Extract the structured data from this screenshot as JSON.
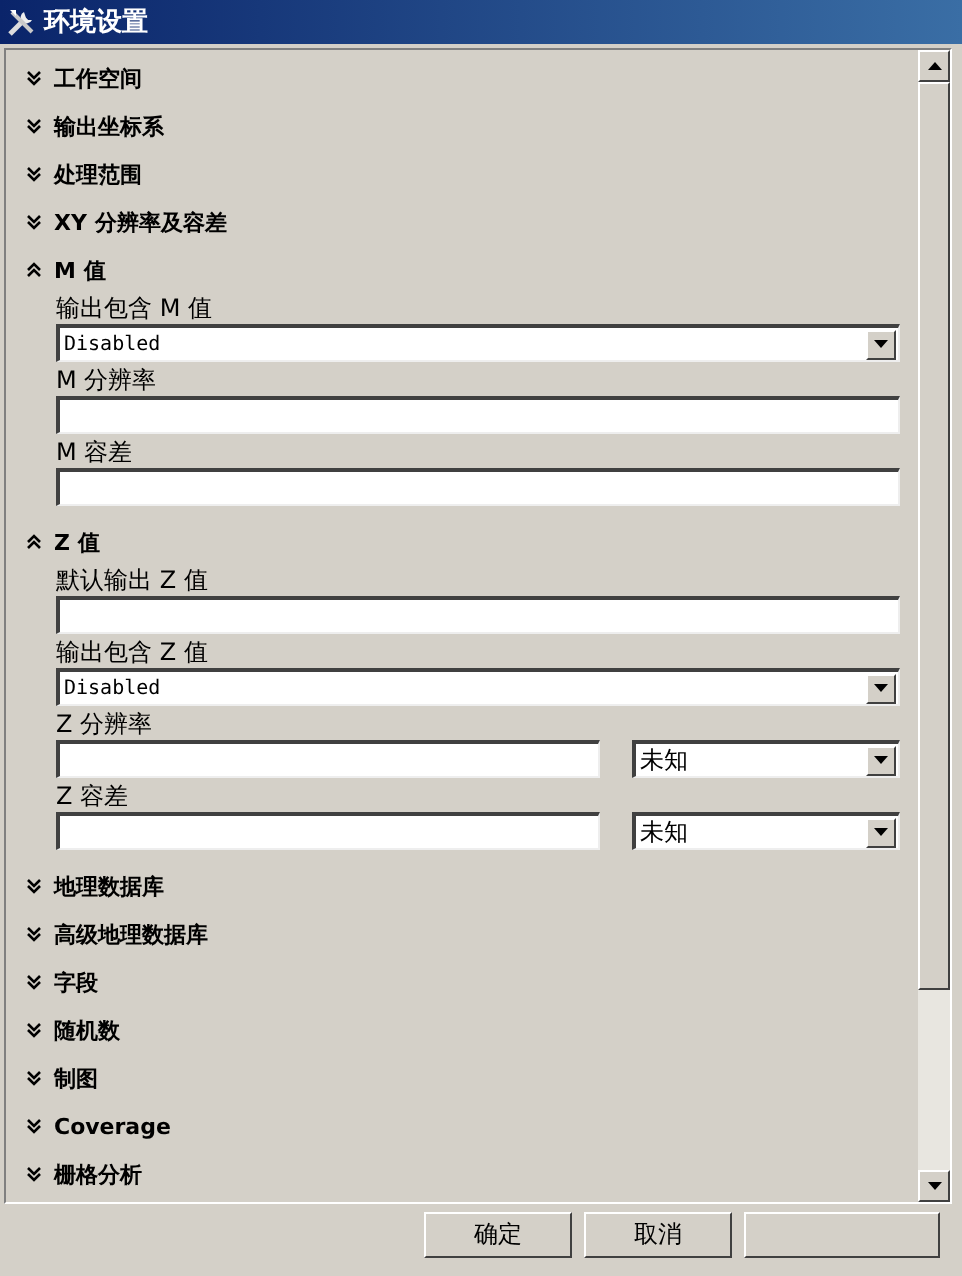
{
  "window": {
    "title": "环境设置"
  },
  "sections": [
    {
      "title": "工作空间",
      "expanded": false
    },
    {
      "title": "输出坐标系",
      "expanded": false
    },
    {
      "title": "处理范围",
      "expanded": false
    },
    {
      "title": "XY 分辨率及容差",
      "expanded": false
    },
    {
      "title": "M 值",
      "expanded": true,
      "fields": [
        {
          "kind": "dropdown",
          "label": "输出包含 M 值",
          "value": "Disabled"
        },
        {
          "kind": "text",
          "label": "M 分辨率"
        },
        {
          "kind": "text",
          "label": "M 容差"
        }
      ]
    },
    {
      "title": "Z 值",
      "expanded": true,
      "fields": [
        {
          "kind": "text",
          "label": "默认输出 Z 值"
        },
        {
          "kind": "dropdown",
          "label": "输出包含 Z 值",
          "value": "Disabled"
        },
        {
          "kind": "text_with_unit",
          "label": "Z 分辨率",
          "unit": "未知"
        },
        {
          "kind": "text_with_unit",
          "label": "Z 容差",
          "unit": "未知"
        }
      ]
    },
    {
      "title": "地理数据库",
      "expanded": false
    },
    {
      "title": "高级地理数据库",
      "expanded": false
    },
    {
      "title": "字段",
      "expanded": false
    },
    {
      "title": "随机数",
      "expanded": false
    },
    {
      "title": "制图",
      "expanded": false
    },
    {
      "title": "Coverage",
      "expanded": false
    },
    {
      "title": "栅格分析",
      "expanded": false
    }
  ],
  "buttons": [
    {
      "label": "确定"
    },
    {
      "label": "取消"
    }
  ]
}
